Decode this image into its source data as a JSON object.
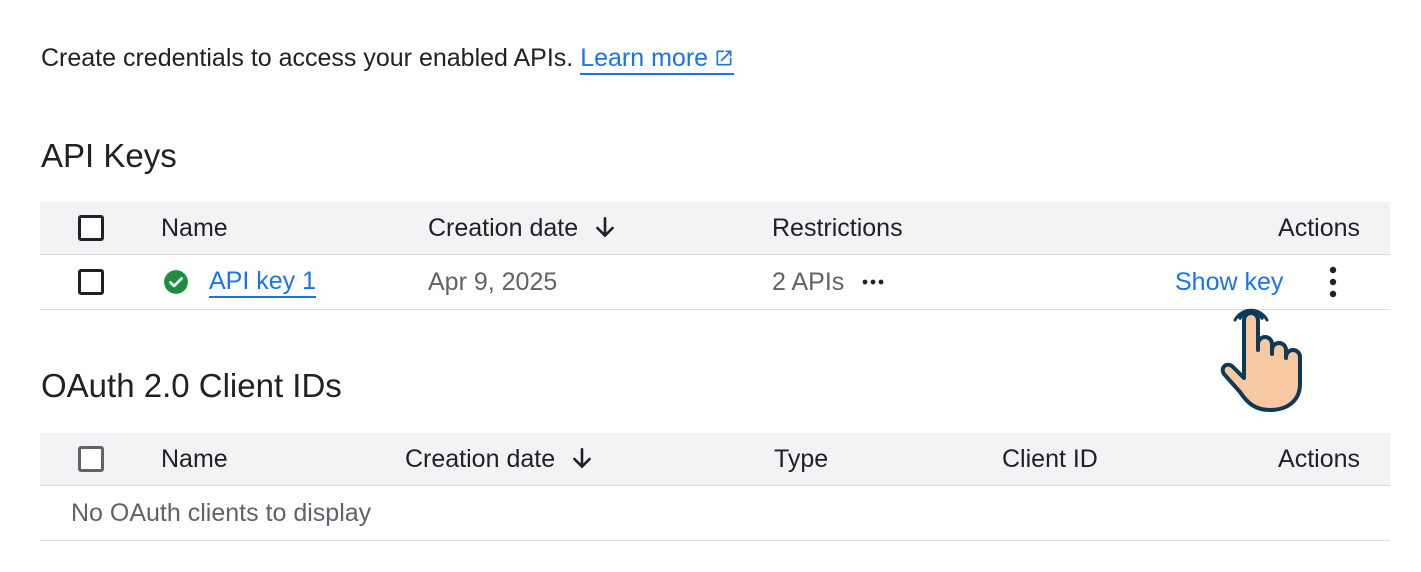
{
  "intro": {
    "text": "Create credentials to access your enabled APIs.",
    "learn_more": "Learn more"
  },
  "api_keys": {
    "title": "API Keys",
    "columns": {
      "name": "Name",
      "creation_date": "Creation date",
      "restrictions": "Restrictions",
      "actions": "Actions"
    },
    "rows": [
      {
        "name": "API key 1",
        "creation_date": "Apr 9, 2025",
        "restrictions": "2 APIs",
        "show_key": "Show key"
      }
    ]
  },
  "oauth": {
    "title": "OAuth 2.0 Client IDs",
    "columns": {
      "name": "Name",
      "creation_date": "Creation date",
      "type": "Type",
      "client_id": "Client ID",
      "actions": "Actions"
    },
    "empty_message": "No OAuth clients to display"
  },
  "colors": {
    "link": "#1a73e8",
    "header_bg": "#f1f3f4",
    "success": "#1e8e3e",
    "text": "#202124",
    "muted_text": "#5f6368",
    "border": "#dadce0",
    "cursor_fill": "#f6c9a2"
  },
  "icons": {
    "external_link": "external-link-icon",
    "sort": "arrow-down-icon",
    "status": "check-circle-icon",
    "more": "more-horizontal-icon",
    "kebab": "more-vertical-icon",
    "cursor": "hand-pointer-icon"
  }
}
